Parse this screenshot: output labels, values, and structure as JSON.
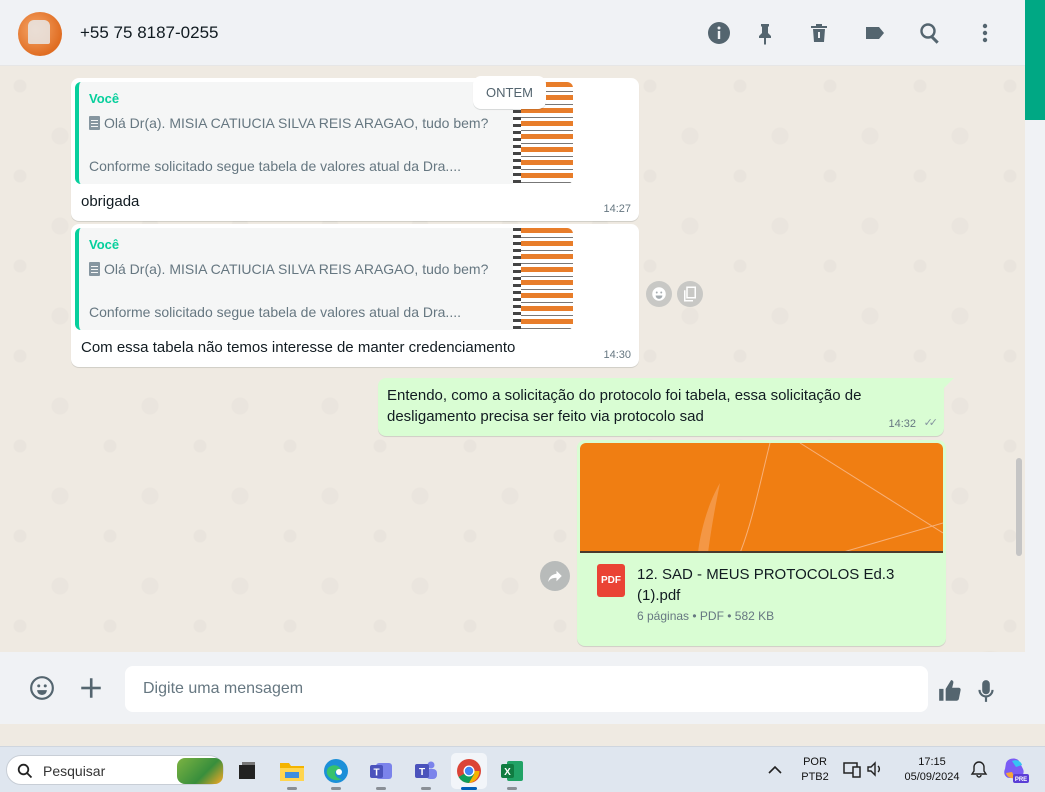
{
  "header": {
    "contact_name": "+55 75 8187-0255",
    "icons": [
      "info-icon",
      "pin-icon",
      "delete-icon",
      "label-icon",
      "search-icon",
      "menu-icon"
    ]
  },
  "chat": {
    "date_separator": "ONTEM",
    "messages": [
      {
        "direction": "in",
        "quoted_author": "Você",
        "quoted_line1": "Olá Dr(a). MISIA CATIUCIA SILVA REIS ARAGAO, tudo bem?",
        "quoted_line2": "Conforme solicitado segue tabela de valores atual da Dra....",
        "text": "obrigada",
        "time": "14:27"
      },
      {
        "direction": "in",
        "quoted_author": "Você",
        "quoted_line1": "Olá Dr(a). MISIA CATIUCIA SILVA REIS ARAGAO, tudo bem?",
        "quoted_line2": "Conforme solicitado segue tabela de valores atual da Dra....",
        "text": "Com essa tabela não temos interesse de manter credenciamento",
        "time": "14:30"
      },
      {
        "direction": "out",
        "text_line1": "Entendo, como a solicitação do protocolo foi tabela, essa solicitação de",
        "text_line2": "desligamento precisa ser feito via protocolo sad",
        "time": "14:32",
        "status": "read"
      },
      {
        "direction": "out",
        "type": "document",
        "file_badge": "PDF",
        "file_name": "12. SAD - MEUS PROTOCOLOS Ed.3 (1).pdf",
        "file_meta": "6 páginas • PDF • 582 KB"
      }
    ]
  },
  "composer": {
    "placeholder": "Digite uma mensagem"
  },
  "taskbar": {
    "search_label": "Pesquisar",
    "language_line1": "POR",
    "language_line2": "PTB2",
    "clock_time": "17:15",
    "clock_date": "05/09/2024",
    "copilot_badge": "PRE",
    "apps": [
      "task-view",
      "file-explorer",
      "edge",
      "teams-classic",
      "teams",
      "chrome",
      "excel"
    ]
  },
  "colors": {
    "accent": "#00a884",
    "quote_bar": "#06cf9c",
    "outgoing_bubble": "#d9fdd3",
    "pdf_preview": "#f07e12"
  }
}
